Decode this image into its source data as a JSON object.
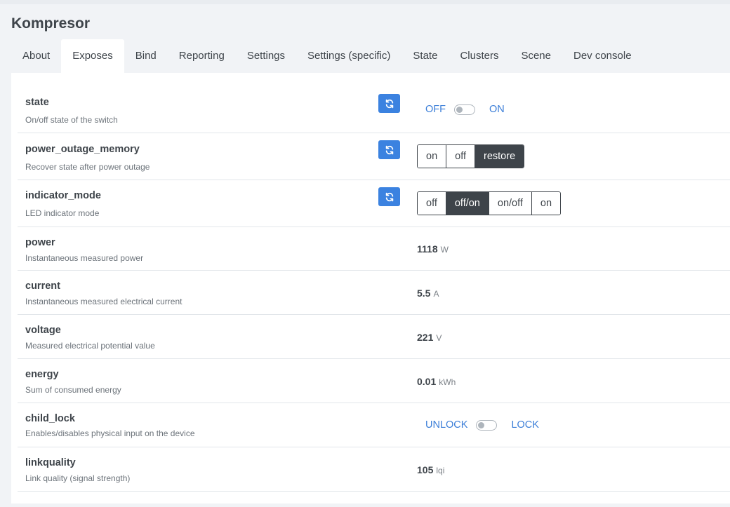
{
  "device": {
    "title": "Kompresor"
  },
  "tabs": [
    {
      "label": "About"
    },
    {
      "label": "Exposes",
      "active": true
    },
    {
      "label": "Bind"
    },
    {
      "label": "Reporting"
    },
    {
      "label": "Settings"
    },
    {
      "label": "Settings (specific)"
    },
    {
      "label": "State"
    },
    {
      "label": "Clusters"
    },
    {
      "label": "Scene"
    },
    {
      "label": "Dev console"
    }
  ],
  "exposes": {
    "state": {
      "name": "state",
      "description": "On/off state of the switch",
      "off_label": "OFF",
      "on_label": "ON"
    },
    "power_outage_memory": {
      "name": "power_outage_memory",
      "description": "Recover state after power outage",
      "options": [
        "on",
        "off",
        "restore"
      ],
      "selected": "restore"
    },
    "indicator_mode": {
      "name": "indicator_mode",
      "description": "LED indicator mode",
      "options": [
        "off",
        "off/on",
        "on/off",
        "on"
      ],
      "selected": "off/on"
    },
    "power": {
      "name": "power",
      "description": "Instantaneous measured power",
      "value": "1118",
      "unit": "W"
    },
    "current": {
      "name": "current",
      "description": "Instantaneous measured electrical current",
      "value": "5.5",
      "unit": "A"
    },
    "voltage": {
      "name": "voltage",
      "description": "Measured electrical potential value",
      "value": "221",
      "unit": "V"
    },
    "energy": {
      "name": "energy",
      "description": "Sum of consumed energy",
      "value": "0.01",
      "unit": "kWh"
    },
    "child_lock": {
      "name": "child_lock",
      "description": "Enables/disables physical input on the device",
      "off_label": "UNLOCK",
      "on_label": "LOCK"
    },
    "linkquality": {
      "name": "linkquality",
      "description": "Link quality (signal strength)",
      "value": "105",
      "unit": "lqi"
    }
  },
  "icons": {
    "refresh": "refresh-icon"
  },
  "colors": {
    "accent": "#3b82e0",
    "link": "#3b7ed8",
    "dark": "#3e444a"
  }
}
